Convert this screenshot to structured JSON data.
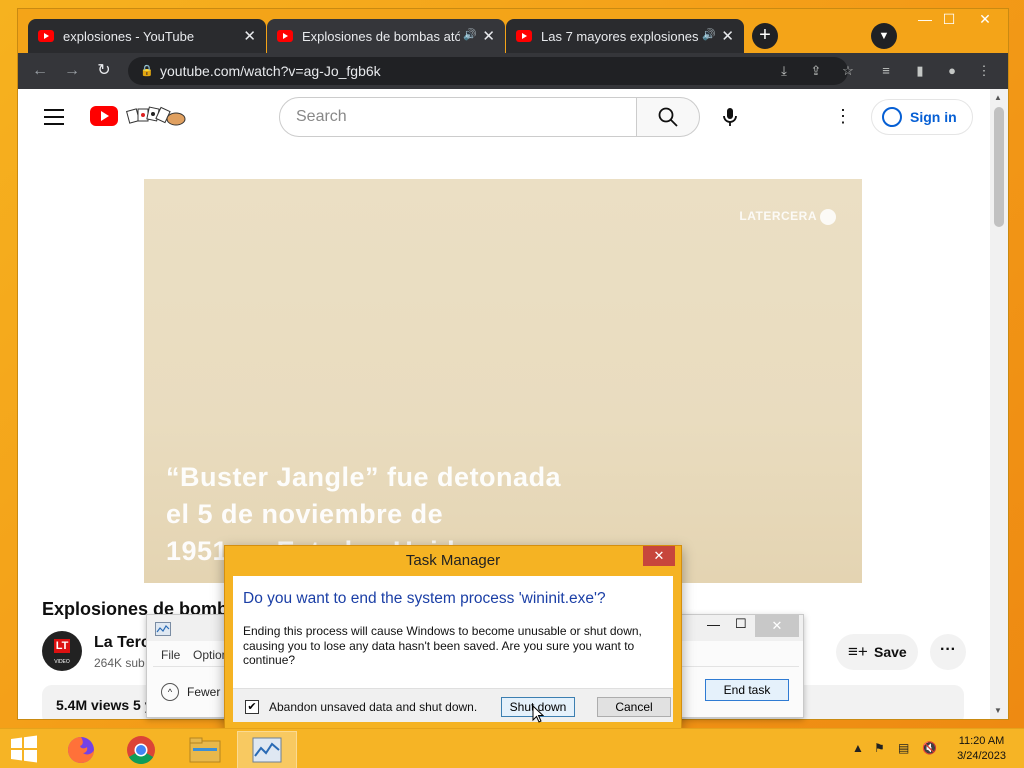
{
  "browser": {
    "tabs": [
      {
        "title": "explosiones - YouTube",
        "audio": false
      },
      {
        "title": "Explosiones de bombas atóm",
        "audio": true
      },
      {
        "title": "Las 7 mayores explosiones n",
        "audio": true
      }
    ],
    "url": "youtube.com/watch?v=ag-Jo_fgb6k"
  },
  "youtube": {
    "search_placeholder": "Search",
    "sign_in": "Sign in",
    "video": {
      "watermark": "LATERCERA",
      "caption_lines": [
        "“Buster Jangle” fue detonada",
        "el 5 de noviembre de",
        "1951 en Estados Unidos"
      ],
      "title": "Explosiones de bomba",
      "channel": "La Terc",
      "channel_avatar": "LT",
      "channel_avatar_sub": "VIDEO",
      "subs": "264K sub",
      "save": "Save",
      "views": "5.4M views  5 y"
    }
  },
  "task_manager_bg": {
    "menu_file": "File",
    "menu_options": "Option",
    "fewer": "Fewer d",
    "end_task": "End task"
  },
  "dialog": {
    "title": "Task Manager",
    "close": "✕",
    "main_instruction": "Do you want to end the system process 'wininit.exe'?",
    "description": "Ending this process will cause Windows to become unusable or shut down, causing you to lose any data hasn't been saved. Are you sure you want to continue?",
    "checkbox_label": "Abandon unsaved data and shut down.",
    "checkbox_checked": true,
    "shutdown_button": "Shut down",
    "cancel_button": "Cancel"
  },
  "taskbar": {
    "time": "11:20 AM",
    "date": "3/24/2023"
  }
}
